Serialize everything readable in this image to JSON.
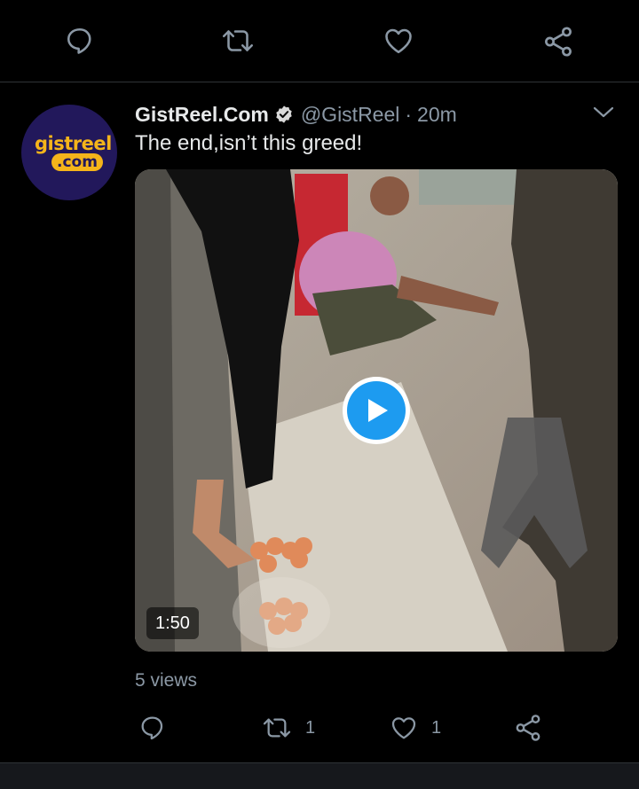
{
  "top_actions": {
    "reply_icon": "reply-icon",
    "retweet_icon": "retweet-icon",
    "like_icon": "heart-icon",
    "share_icon": "share-icon"
  },
  "tweet": {
    "avatar": {
      "line1": "gistreel",
      "line2": ".com",
      "bg_color": "#22185b",
      "text_color": "#f5b41a"
    },
    "display_name": "GistReel.Com",
    "verified": true,
    "handle": "@GistReel",
    "separator": "·",
    "time": "20m",
    "text": "The end,isn’t this greed!",
    "media": {
      "type": "video",
      "duration": "1:50",
      "play_color": "#1d9bf0"
    },
    "views": "5 views",
    "actions": {
      "reply_count": "",
      "retweet_count": "1",
      "like_count": "1",
      "share_icon": "share-icon"
    }
  },
  "colors": {
    "background": "#000000",
    "muted": "#8b98a5",
    "accent": "#1d9bf0"
  }
}
